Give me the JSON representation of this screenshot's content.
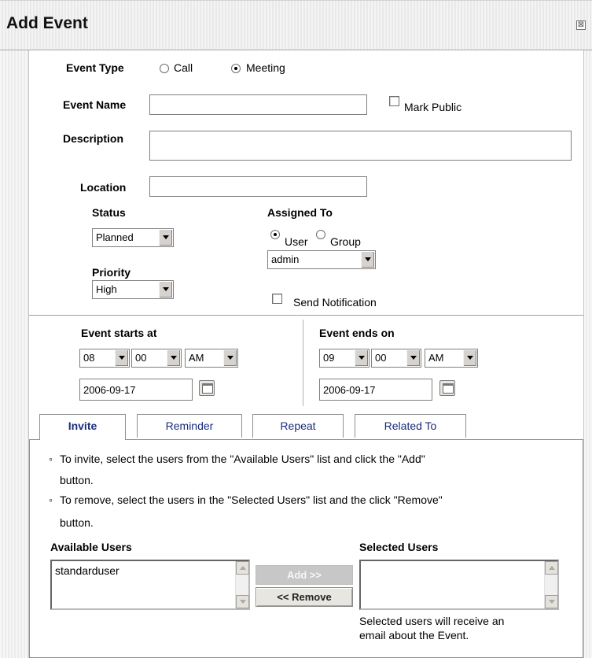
{
  "dialog": {
    "title": "Add Event",
    "close_symbol": "⊠"
  },
  "event_type": {
    "label": "Event Type",
    "options": [
      "Call",
      "Meeting"
    ],
    "selected": "Meeting"
  },
  "event_name": {
    "label": "Event Name",
    "value": "",
    "mark_public_label": "Mark Public",
    "mark_public_checked": false
  },
  "description": {
    "label": "Description",
    "value": ""
  },
  "location": {
    "label": "Location",
    "value": ""
  },
  "status": {
    "label": "Status",
    "value": "Planned"
  },
  "priority": {
    "label": "Priority",
    "value": "High"
  },
  "assigned_to": {
    "label": "Assigned To",
    "options": [
      "User",
      "Group"
    ],
    "selected": "User",
    "user_value": "admin",
    "send_notification_label": "Send Notification",
    "send_notification_checked": false
  },
  "start": {
    "label": "Event starts at",
    "hour": "08",
    "minute": "00",
    "ampm": "AM",
    "date": "2006-09-17"
  },
  "end": {
    "label": "Event ends on",
    "hour": "09",
    "minute": "00",
    "ampm": "AM",
    "date": "2006-09-17"
  },
  "tabs": [
    {
      "label": "Invite",
      "active": true
    },
    {
      "label": "Reminder",
      "active": false
    },
    {
      "label": "Repeat",
      "active": false
    },
    {
      "label": "Related To",
      "active": false
    }
  ],
  "invite": {
    "instructions": [
      {
        "line1": "To invite, select the users from the \"Available Users\" list and click the \"Add\"",
        "line2": "button."
      },
      {
        "line1": "To remove, select the users in the \"Selected Users\" list and the click \"Remove\"",
        "line2": "button."
      }
    ],
    "available_users_label": "Available Users",
    "available_users": [
      "standarduser"
    ],
    "selected_users_label": "Selected Users",
    "selected_users": [],
    "add_button": "Add >>",
    "remove_button": "<< Remove",
    "note_line1": "Selected users will receive an",
    "note_line2": "email about the Event."
  }
}
